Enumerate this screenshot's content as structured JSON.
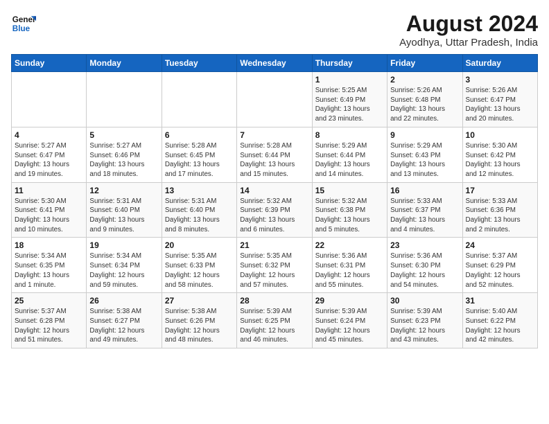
{
  "header": {
    "logo_general": "General",
    "logo_blue": "Blue",
    "month_year": "August 2024",
    "location": "Ayodhya, Uttar Pradesh, India"
  },
  "weekdays": [
    "Sunday",
    "Monday",
    "Tuesday",
    "Wednesday",
    "Thursday",
    "Friday",
    "Saturday"
  ],
  "weeks": [
    [
      {
        "day": "",
        "info": ""
      },
      {
        "day": "",
        "info": ""
      },
      {
        "day": "",
        "info": ""
      },
      {
        "day": "",
        "info": ""
      },
      {
        "day": "1",
        "info": "Sunrise: 5:25 AM\nSunset: 6:49 PM\nDaylight: 13 hours\nand 23 minutes."
      },
      {
        "day": "2",
        "info": "Sunrise: 5:26 AM\nSunset: 6:48 PM\nDaylight: 13 hours\nand 22 minutes."
      },
      {
        "day": "3",
        "info": "Sunrise: 5:26 AM\nSunset: 6:47 PM\nDaylight: 13 hours\nand 20 minutes."
      }
    ],
    [
      {
        "day": "4",
        "info": "Sunrise: 5:27 AM\nSunset: 6:47 PM\nDaylight: 13 hours\nand 19 minutes."
      },
      {
        "day": "5",
        "info": "Sunrise: 5:27 AM\nSunset: 6:46 PM\nDaylight: 13 hours\nand 18 minutes."
      },
      {
        "day": "6",
        "info": "Sunrise: 5:28 AM\nSunset: 6:45 PM\nDaylight: 13 hours\nand 17 minutes."
      },
      {
        "day": "7",
        "info": "Sunrise: 5:28 AM\nSunset: 6:44 PM\nDaylight: 13 hours\nand 15 minutes."
      },
      {
        "day": "8",
        "info": "Sunrise: 5:29 AM\nSunset: 6:44 PM\nDaylight: 13 hours\nand 14 minutes."
      },
      {
        "day": "9",
        "info": "Sunrise: 5:29 AM\nSunset: 6:43 PM\nDaylight: 13 hours\nand 13 minutes."
      },
      {
        "day": "10",
        "info": "Sunrise: 5:30 AM\nSunset: 6:42 PM\nDaylight: 13 hours\nand 12 minutes."
      }
    ],
    [
      {
        "day": "11",
        "info": "Sunrise: 5:30 AM\nSunset: 6:41 PM\nDaylight: 13 hours\nand 10 minutes."
      },
      {
        "day": "12",
        "info": "Sunrise: 5:31 AM\nSunset: 6:40 PM\nDaylight: 13 hours\nand 9 minutes."
      },
      {
        "day": "13",
        "info": "Sunrise: 5:31 AM\nSunset: 6:40 PM\nDaylight: 13 hours\nand 8 minutes."
      },
      {
        "day": "14",
        "info": "Sunrise: 5:32 AM\nSunset: 6:39 PM\nDaylight: 13 hours\nand 6 minutes."
      },
      {
        "day": "15",
        "info": "Sunrise: 5:32 AM\nSunset: 6:38 PM\nDaylight: 13 hours\nand 5 minutes."
      },
      {
        "day": "16",
        "info": "Sunrise: 5:33 AM\nSunset: 6:37 PM\nDaylight: 13 hours\nand 4 minutes."
      },
      {
        "day": "17",
        "info": "Sunrise: 5:33 AM\nSunset: 6:36 PM\nDaylight: 13 hours\nand 2 minutes."
      }
    ],
    [
      {
        "day": "18",
        "info": "Sunrise: 5:34 AM\nSunset: 6:35 PM\nDaylight: 13 hours\nand 1 minute."
      },
      {
        "day": "19",
        "info": "Sunrise: 5:34 AM\nSunset: 6:34 PM\nDaylight: 12 hours\nand 59 minutes."
      },
      {
        "day": "20",
        "info": "Sunrise: 5:35 AM\nSunset: 6:33 PM\nDaylight: 12 hours\nand 58 minutes."
      },
      {
        "day": "21",
        "info": "Sunrise: 5:35 AM\nSunset: 6:32 PM\nDaylight: 12 hours\nand 57 minutes."
      },
      {
        "day": "22",
        "info": "Sunrise: 5:36 AM\nSunset: 6:31 PM\nDaylight: 12 hours\nand 55 minutes."
      },
      {
        "day": "23",
        "info": "Sunrise: 5:36 AM\nSunset: 6:30 PM\nDaylight: 12 hours\nand 54 minutes."
      },
      {
        "day": "24",
        "info": "Sunrise: 5:37 AM\nSunset: 6:29 PM\nDaylight: 12 hours\nand 52 minutes."
      }
    ],
    [
      {
        "day": "25",
        "info": "Sunrise: 5:37 AM\nSunset: 6:28 PM\nDaylight: 12 hours\nand 51 minutes."
      },
      {
        "day": "26",
        "info": "Sunrise: 5:38 AM\nSunset: 6:27 PM\nDaylight: 12 hours\nand 49 minutes."
      },
      {
        "day": "27",
        "info": "Sunrise: 5:38 AM\nSunset: 6:26 PM\nDaylight: 12 hours\nand 48 minutes."
      },
      {
        "day": "28",
        "info": "Sunrise: 5:39 AM\nSunset: 6:25 PM\nDaylight: 12 hours\nand 46 minutes."
      },
      {
        "day": "29",
        "info": "Sunrise: 5:39 AM\nSunset: 6:24 PM\nDaylight: 12 hours\nand 45 minutes."
      },
      {
        "day": "30",
        "info": "Sunrise: 5:39 AM\nSunset: 6:23 PM\nDaylight: 12 hours\nand 43 minutes."
      },
      {
        "day": "31",
        "info": "Sunrise: 5:40 AM\nSunset: 6:22 PM\nDaylight: 12 hours\nand 42 minutes."
      }
    ]
  ]
}
